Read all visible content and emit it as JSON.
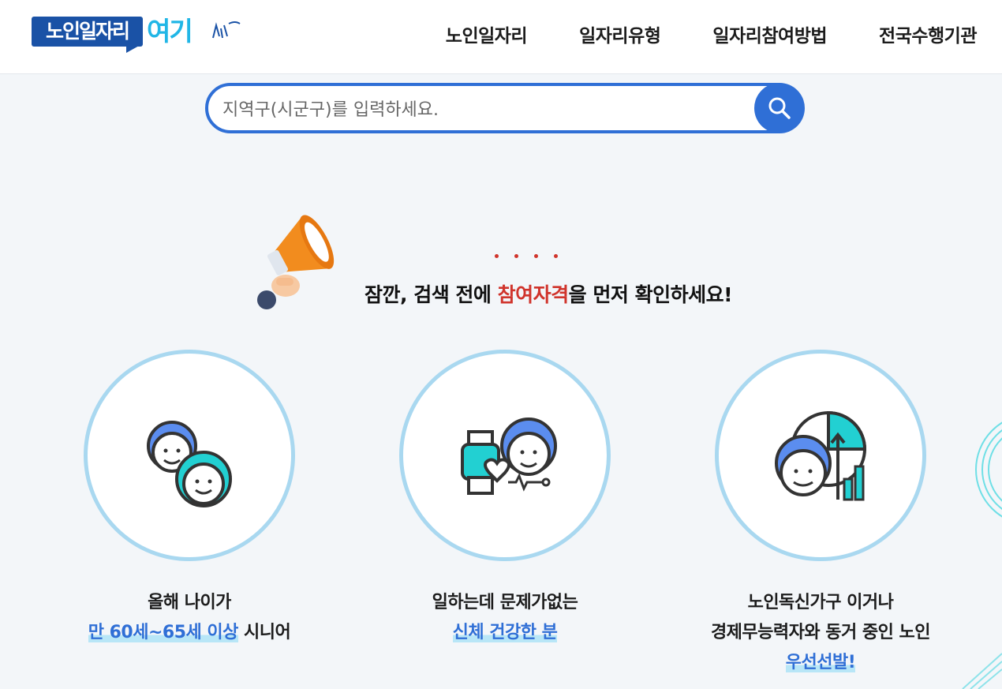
{
  "header": {
    "logo_text": "노인일자리",
    "logo_accent": "여기",
    "nav": [
      "노인일자리",
      "일자리유형",
      "일자리참여방법",
      "전국수행기관"
    ]
  },
  "search": {
    "placeholder": "지역구(시군구)를 입력하세요.",
    "value": ""
  },
  "notice": {
    "dots": "· · · ·",
    "prefix": "잠깐, 검색 전에 ",
    "highlight": "참여자격",
    "suffix": "을 먼저 확인하세요!"
  },
  "cards": [
    {
      "icon": "seniors-couple-icon",
      "line1": "올해 나이가",
      "highlight": "만 60세~65세 이상",
      "line2_rest": " 시니어"
    },
    {
      "icon": "smartwatch-health-icon",
      "line1": "일하는데 문제가없는",
      "highlight": "신체 건강한 분",
      "line2_rest": ""
    },
    {
      "icon": "senior-chart-icon",
      "line1": "노인독신가구 이거나",
      "line2": "경제무능력자와 동거 중인 노인",
      "highlight": "우선선발!"
    }
  ],
  "colors": {
    "brand_blue": "#1a52a6",
    "accent_blue": "#2f6fd6",
    "accent_cyan": "#21b6e6",
    "highlight_red": "#d0342c",
    "circle_border": "#a9d8f0"
  }
}
